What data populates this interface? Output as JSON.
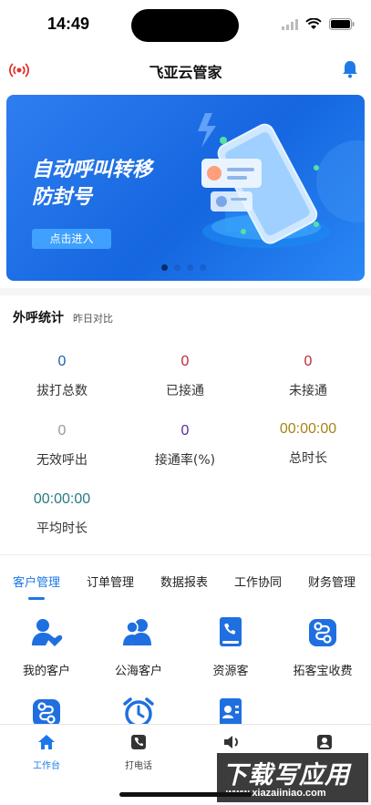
{
  "status_bar": {
    "time": "14:49"
  },
  "nav": {
    "title": "飞亚云管家",
    "left_icon": "broadcast-icon",
    "right_icon": "bell-icon"
  },
  "banner": {
    "title_line1": "自动呼叫转移",
    "title_line2": "防封号",
    "button_label": "点击进入",
    "page_count": 4,
    "active_page": 1
  },
  "stats": {
    "title": "外呼统计",
    "subtitle": "昨日对比",
    "items": [
      {
        "value": "0",
        "label": "拔打总数",
        "color": "#1f5fa8"
      },
      {
        "value": "0",
        "label": "已接通",
        "color": "#c0283a"
      },
      {
        "value": "0",
        "label": "未接通",
        "color": "#c0283a"
      },
      {
        "value": "0",
        "label": "无效呼出",
        "color": "#999999"
      },
      {
        "value": "0",
        "label": "接通率(%)",
        "color": "#5a2aa0"
      },
      {
        "value": "00:00:00",
        "label": "总时长",
        "color": "#a58516"
      },
      {
        "value": "00:00:00",
        "label": "平均时长",
        "color": "#2a7a84"
      }
    ]
  },
  "tabs": [
    {
      "label": "客户管理",
      "active": true
    },
    {
      "label": "订单管理",
      "active": false
    },
    {
      "label": "数据报表",
      "active": false
    },
    {
      "label": "工作协同",
      "active": false
    },
    {
      "label": "财务管理",
      "active": false
    }
  ],
  "grid": [
    {
      "label": "我的客户",
      "icon": "my-customers-icon"
    },
    {
      "label": "公海客户",
      "icon": "public-customers-icon"
    },
    {
      "label": "资源客",
      "icon": "resource-customers-icon"
    },
    {
      "label": "拓客宝收费",
      "icon": "route-icon"
    },
    {
      "label": "",
      "icon": "route-icon"
    },
    {
      "label": "",
      "icon": "alarm-clock-icon"
    },
    {
      "label": "",
      "icon": "contact-card-icon"
    }
  ],
  "tabbar": [
    {
      "label": "工作台",
      "icon": "home-icon",
      "active": true
    },
    {
      "label": "打电话",
      "icon": "phone-icon",
      "active": false
    },
    {
      "label": "",
      "icon": "speaker-icon",
      "active": false
    },
    {
      "label": "",
      "icon": "contact-icon",
      "active": false
    }
  ],
  "watermark": {
    "big": "下载写应用",
    "small": "www.xiazaiiniao.com"
  },
  "colors": {
    "accent": "#1b78e8",
    "icon_blue": "#1f6fe0"
  }
}
